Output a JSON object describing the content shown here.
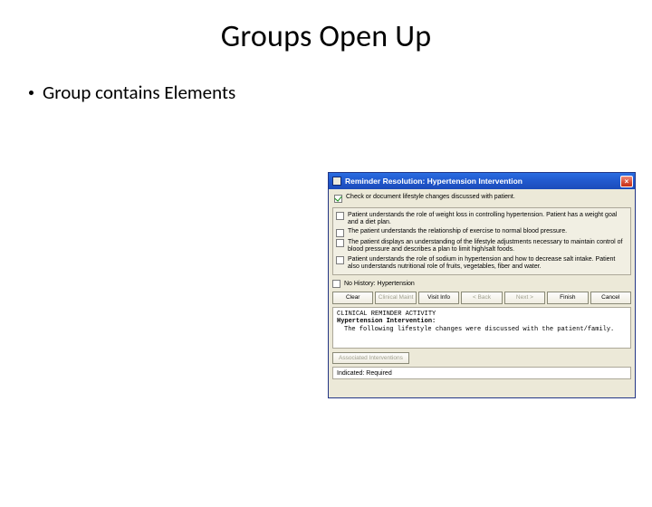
{
  "slide": {
    "title": "Groups Open Up",
    "bullet": "Group contains Elements"
  },
  "dialog": {
    "title": "Reminder Resolution: Hypertension Intervention",
    "topCheckbox": {
      "checked": true,
      "label": "Check or document lifestyle changes discussed with patient."
    },
    "groupItems": [
      "Patient understands the role of weight loss in controlling hypertension. Patient has a weight goal and a diet plan.",
      "The patient understands the relationship of exercise to normal blood pressure.",
      "The patient displays an understanding of the lifestyle adjustments necessary to maintain control of blood pressure and describes a plan to limit high/salt foods.",
      "Patient understands the role of sodium in hypertension and how to decrease salt intake. Patient also understands nutritional role of fruits, vegetables, fiber and water."
    ],
    "hxCheckbox": {
      "checked": false,
      "label": "No History: Hypertension"
    },
    "buttons": [
      {
        "label": "Clear",
        "disabled": false
      },
      {
        "label": "Clinical Maint",
        "disabled": true
      },
      {
        "label": "Visit Info",
        "disabled": false
      },
      {
        "label": "< Back",
        "disabled": true
      },
      {
        "label": "Next >",
        "disabled": true
      },
      {
        "label": "Finish",
        "disabled": false
      },
      {
        "label": "Cancel",
        "disabled": false
      }
    ],
    "noteHeader": "CLINICAL REMINDER ACTIVITY",
    "noteTitle": "Hypertension Intervention:",
    "noteBody": "The following lifestyle changes were discussed with the patient/family.",
    "maintButton": "Associated Interventions",
    "indicatedLabel": "Indicated: Required"
  }
}
